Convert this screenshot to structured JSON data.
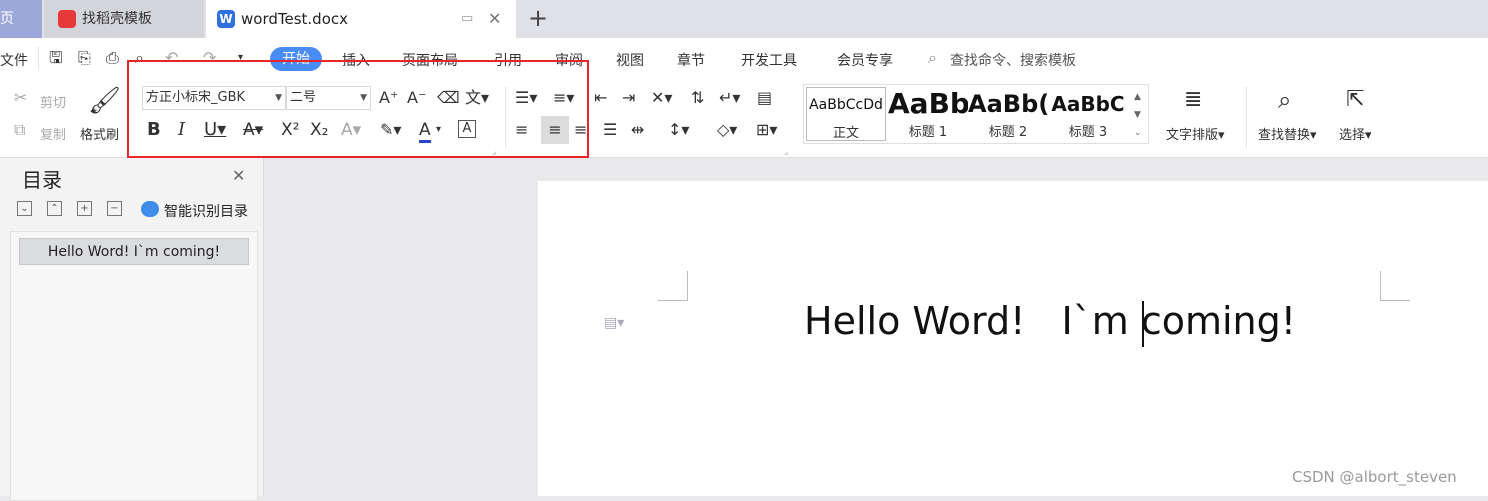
{
  "tabs": {
    "home": "页",
    "templates": "找稻壳模板",
    "doc": "wordTest.docx",
    "add": "+"
  },
  "menu": {
    "file": "文件",
    "start": "开始",
    "insert": "插入",
    "layout": "页面布局",
    "references": "引用",
    "review": "审阅",
    "view": "视图",
    "chapter": "章节",
    "devtools": "开发工具",
    "member": "会员专享",
    "search_placeholder": "查找命令、搜索模板"
  },
  "clipboard": {
    "cut": "剪切",
    "copy": "复制",
    "format_painter": "格式刷"
  },
  "font": {
    "name": "方正小标宋_GBK",
    "size": "二号"
  },
  "styles": {
    "normal": {
      "sample": "AaBbCcDd",
      "name": "正文"
    },
    "h1": {
      "sample": "AaBb",
      "name": "标题 1"
    },
    "h2": {
      "sample": "AaBb(",
      "name": "标题 2"
    },
    "h3": {
      "sample": "AaBbC",
      "name": "标题 3"
    }
  },
  "ribbon_right": {
    "text_layout": "文字排版",
    "find_replace": "查找替换",
    "select": "选择"
  },
  "toc": {
    "title": "目录",
    "smart": "智能识别目录",
    "item": "Hello Word!  I`m coming!"
  },
  "document": {
    "text": "Hello Word!   I`m coming!"
  },
  "watermark": "CSDN @albort_steven",
  "colors": {
    "accent": "#4a8cf5",
    "highlight_box": "#e8252b",
    "wps_red": "#e63a3a",
    "wps_blue": "#2f6fe0"
  }
}
